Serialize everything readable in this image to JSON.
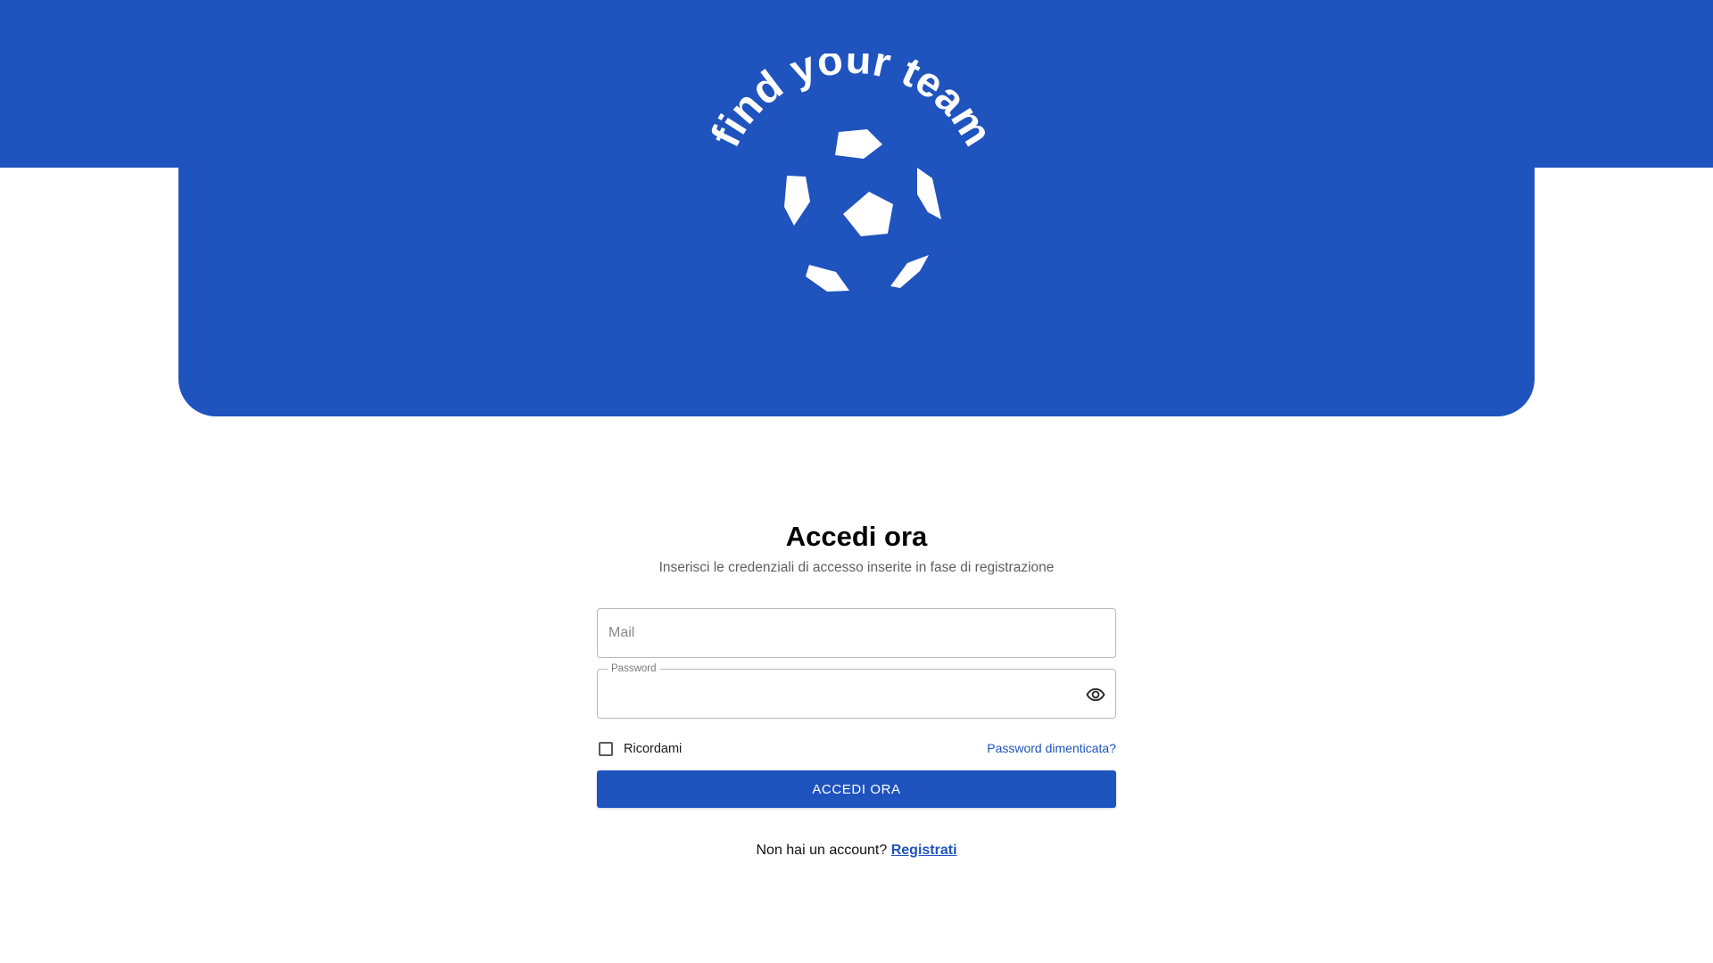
{
  "brand": {
    "logo_text": "find your team",
    "primary_color": "#1f53be",
    "logo_color": "#ffffff",
    "logo_icon": "soccer-ball-icon"
  },
  "login": {
    "title": "Accedi ora",
    "subtitle": "Inserisci le credenziali di accesso inserite in fase di registrazione",
    "mail": {
      "placeholder": "Mail",
      "value": ""
    },
    "password": {
      "label": "Password",
      "value": "",
      "toggle_icon": "eye-icon"
    },
    "remember_label": "Ricordami",
    "remember_checked": false,
    "forgot_label": "Password dimenticata?",
    "submit_label": "ACCEDI ORA",
    "no_account_text": "Non hai un account?",
    "register_label": "Registrati"
  }
}
